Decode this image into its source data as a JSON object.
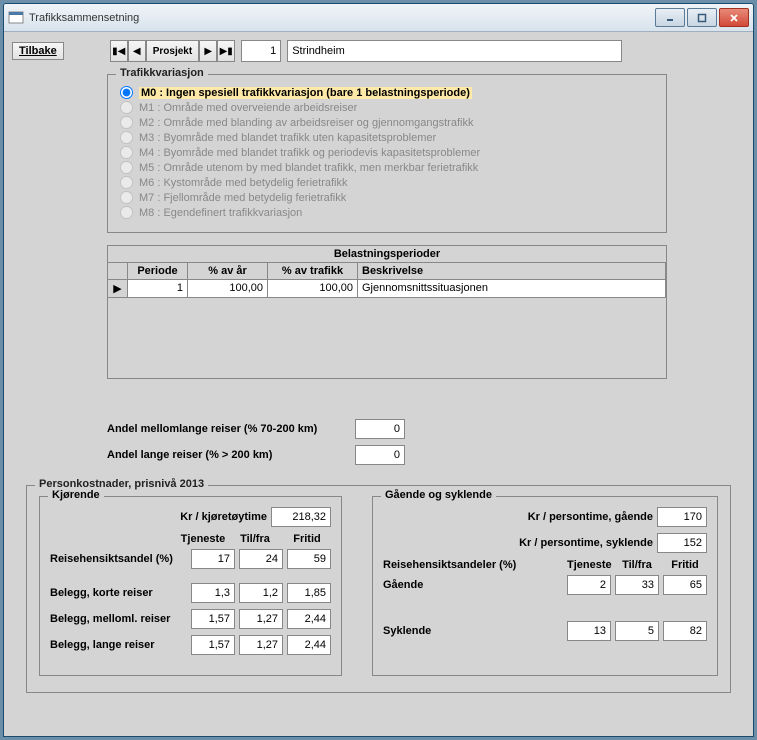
{
  "window": {
    "title": "Trafikksammensetning"
  },
  "toolbar": {
    "back_label": "Tilbake",
    "proj_label": "Prosjekt",
    "proj_num": "1",
    "proj_name": "Strindheim"
  },
  "trafikkvar": {
    "title": "Trafikkvariasjon",
    "options": [
      "M0 : Ingen spesiell trafikkvariasjon (bare 1 belastningsperiode)",
      "M1 : Område med overveiende arbeidsreiser",
      "M2 : Område med blanding av arbeidsreiser og gjennomgangstrafikk",
      "M3 : Byområde med blandet trafikk uten kapasitetsproblemer",
      "M4 : Byområde med blandet trafikk og periodevis kapasitetsproblemer",
      "M5 : Område utenom by med blandet trafikk, men merkbar ferietrafikk",
      "M6 : Kystområde med betydelig ferietrafikk",
      "M7 : Fjellområde med betydelig ferietrafikk",
      "M8 : Egendefinert trafikkvariasjon"
    ]
  },
  "belast": {
    "title": "Belastningsperioder",
    "headers": {
      "periode": "Periode",
      "pct_ar": "% av år",
      "pct_trafikk": "% av trafikk",
      "beskr": "Beskrivelse"
    },
    "rows": [
      {
        "periode": "1",
        "pct_ar": "100,00",
        "pct_trafikk": "100,00",
        "beskr": "Gjennomsnittssituasjonen"
      }
    ]
  },
  "andel": {
    "mellom_label": "Andel mellomlange reiser (% 70-200 km)",
    "mellom_value": "0",
    "lange_label": "Andel lange reiser (% > 200 km)",
    "lange_value": "0"
  },
  "personkost": {
    "title": "Personkostnader, prisnivå 2013",
    "kjorende": {
      "title": "Kjørende",
      "kr_kjtime_label": "Kr / kjøretøytime",
      "kr_kjtime_value": "218,32",
      "col_headers": {
        "tjeneste": "Tjeneste",
        "tilfra": "Til/fra",
        "fritid": "Fritid"
      },
      "reisehensikt_label": "Reisehensiktsandel (%)",
      "reisehensikt": {
        "tjeneste": "17",
        "tilfra": "24",
        "fritid": "59"
      },
      "belegg_korte_label": "Belegg, korte reiser",
      "belegg_korte": {
        "tjeneste": "1,3",
        "tilfra": "1,2",
        "fritid": "1,85"
      },
      "belegg_mellom_label": "Belegg, melloml. reiser",
      "belegg_mellom": {
        "tjeneste": "1,57",
        "tilfra": "1,27",
        "fritid": "2,44"
      },
      "belegg_lange_label": "Belegg, lange reiser",
      "belegg_lange": {
        "tjeneste": "1,57",
        "tilfra": "1,27",
        "fritid": "2,44"
      }
    },
    "gos": {
      "title": "Gående og syklende",
      "kr_gaende_label": "Kr / persontime, gående",
      "kr_gaende_value": "170",
      "kr_syklende_label": "Kr / persontime, syklende",
      "kr_syklende_value": "152",
      "reisehensikt_label": "Reisehensiktsandeler (%)",
      "col_headers": {
        "tjeneste": "Tjeneste",
        "tilfra": "Til/fra",
        "fritid": "Fritid"
      },
      "gaende_label": "Gående",
      "gaende": {
        "tjeneste": "2",
        "tilfra": "33",
        "fritid": "65"
      },
      "syklende_label": "Syklende",
      "syklende": {
        "tjeneste": "13",
        "tilfra": "5",
        "fritid": "82"
      }
    }
  }
}
